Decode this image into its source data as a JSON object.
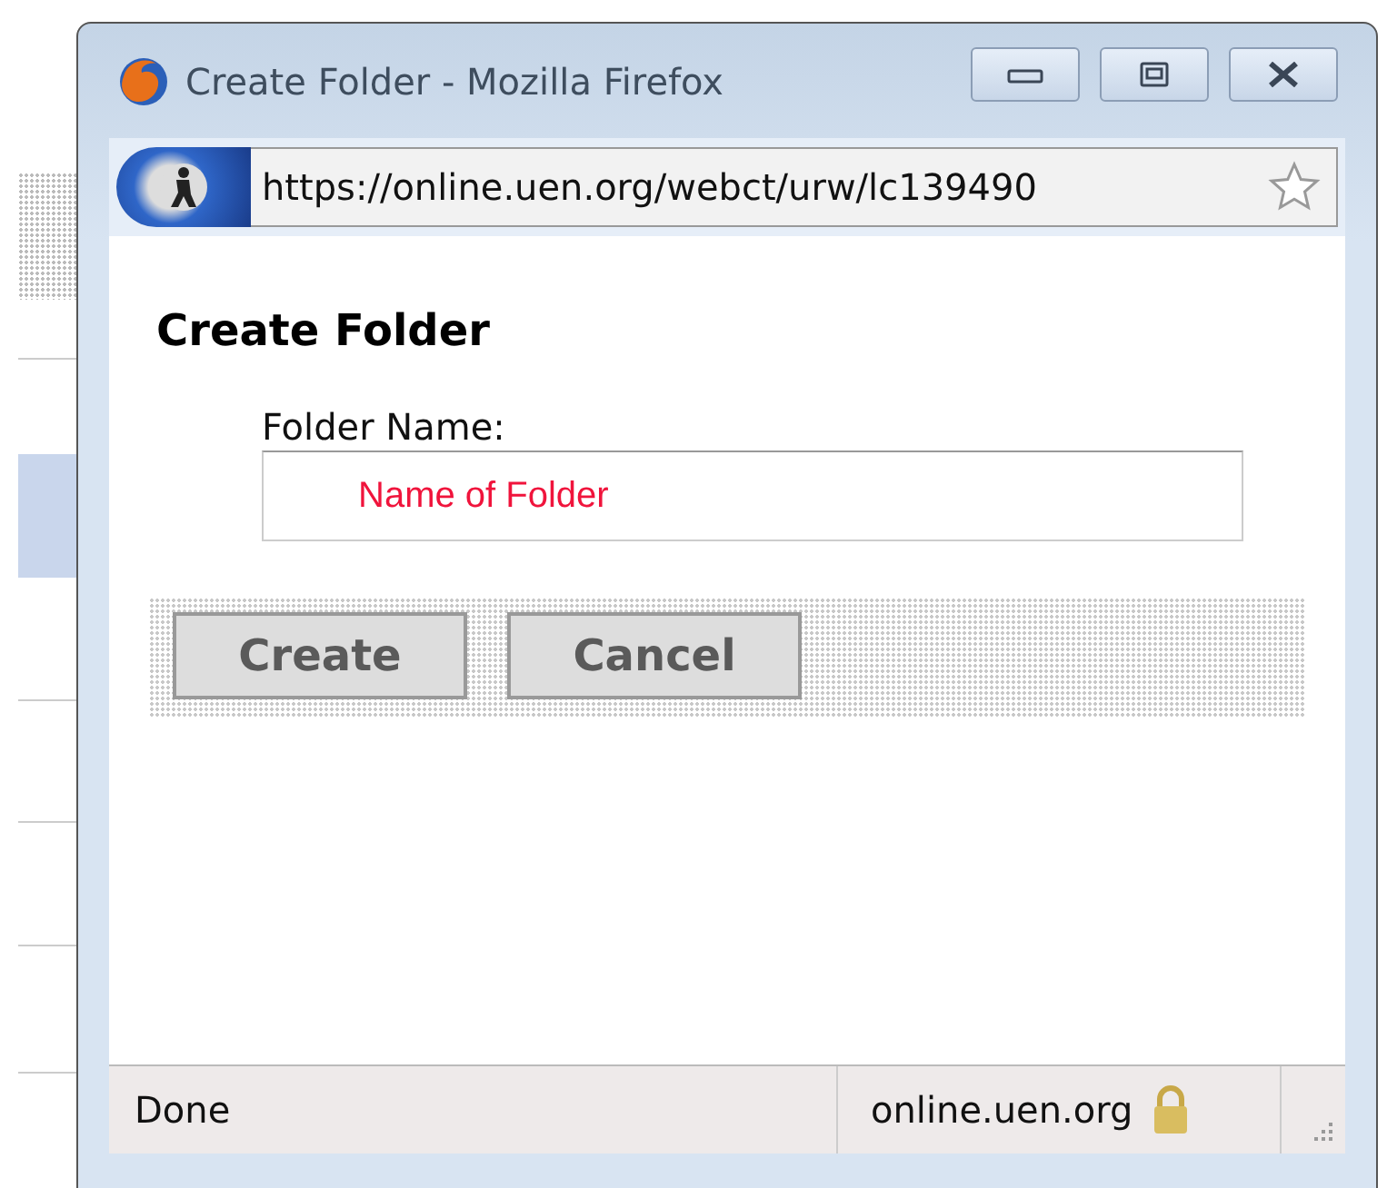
{
  "window": {
    "title": "Create Folder - Mozilla Firefox"
  },
  "address_bar": {
    "url": "https://online.uen.org/webct/urw/lc139490"
  },
  "page": {
    "heading": "Create Folder",
    "field": {
      "label": "Folder Name:",
      "value": "Name of Folder"
    },
    "buttons": [
      {
        "label": "Create",
        "disabled": true
      },
      {
        "label": "Cancel",
        "disabled": true
      }
    ]
  },
  "status_bar": {
    "status": "Done",
    "domain": "online.uen.org",
    "secure": true
  }
}
